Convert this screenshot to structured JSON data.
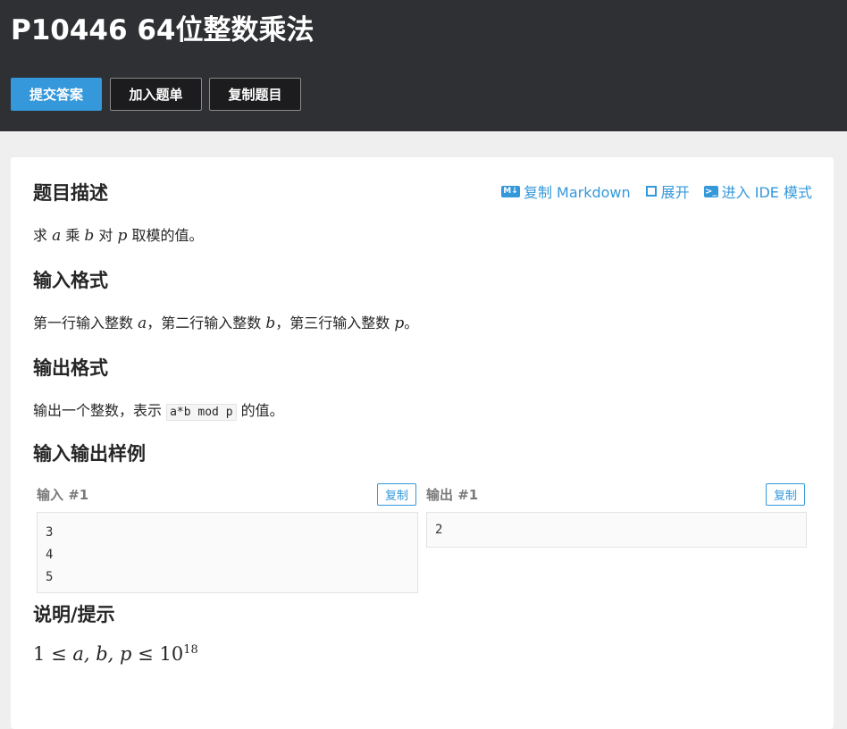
{
  "header": {
    "title": "P10446 64位整数乘法",
    "buttons": {
      "submit": "提交答案",
      "add_to_list": "加入题单",
      "copy_problem": "复制题目"
    }
  },
  "actions": {
    "copy_markdown": "复制 Markdown",
    "expand": "展开",
    "ide_mode": "进入 IDE 模式",
    "md_icon_text": "M↓",
    "terminal_icon_text": ">_"
  },
  "description": {
    "heading": "题目描述",
    "parts": [
      "求 ",
      "a",
      " 乘 ",
      "b",
      " 对 ",
      "p",
      " 取模的值。"
    ]
  },
  "input_format": {
    "heading": "输入格式",
    "parts": [
      "第一行输入整数 ",
      "a",
      "，第二行输入整数 ",
      "b",
      "，第三行输入整数 ",
      "p",
      "。"
    ]
  },
  "output_format": {
    "heading": "输出格式",
    "before": "输出一个整数，表示 ",
    "code": "a*b mod p",
    "after": " 的值。"
  },
  "samples": {
    "heading": "输入输出样例",
    "input_label": "输入 #1",
    "output_label": "输出 #1",
    "copy_label": "复制",
    "input_lines": [
      "3",
      "4",
      "5"
    ],
    "output_lines": [
      "2"
    ]
  },
  "hint": {
    "heading": "说明/提示",
    "formula": {
      "left": "1",
      "leq": "≤",
      "vars": "a, b, p",
      "base": "10",
      "exp": "18"
    }
  },
  "colors": {
    "accent": "#3498db",
    "header_bg": "#2f3033",
    "page_bg": "#efefef"
  }
}
